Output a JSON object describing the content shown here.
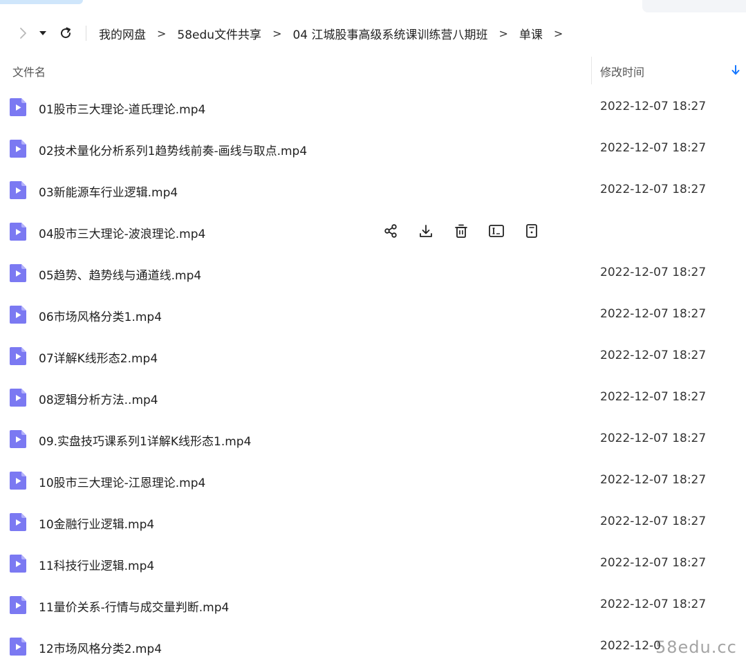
{
  "breadcrumb": [
    {
      "label": "我的网盘"
    },
    {
      "label": "58edu文件共享"
    },
    {
      "label": "04 江城股事高级系统课训练营八期班"
    },
    {
      "label": "单课"
    }
  ],
  "breadcrumb_separator": ">",
  "columns": {
    "name": "文件名",
    "modified": "修改时间"
  },
  "files": [
    {
      "name": "01股市三大理论-道氏理论.mp4",
      "time": "2022-12-07 18:27"
    },
    {
      "name": "02技术量化分析系列1趋势线前奏-画线与取点.mp4",
      "time": "2022-12-07 18:27"
    },
    {
      "name": "03新能源车行业逻辑.mp4",
      "time": "2022-12-07 18:27"
    },
    {
      "name": "04股市三大理论-波浪理论.mp4",
      "time": ""
    },
    {
      "name": "05趋势、趋势线与通道线.mp4",
      "time": "2022-12-07 18:27"
    },
    {
      "name": "06市场风格分类1.mp4",
      "time": "2022-12-07 18:27"
    },
    {
      "name": "07详解K线形态2.mp4",
      "time": "2022-12-07 18:27"
    },
    {
      "name": "08逻辑分析方法..mp4",
      "time": "2022-12-07 18:27"
    },
    {
      "name": "09.实盘技巧课系列1详解K线形态1.mp4",
      "time": "2022-12-07 18:27"
    },
    {
      "name": "10股市三大理论-江恩理论.mp4",
      "time": "2022-12-07 18:27"
    },
    {
      "name": "10金融行业逻辑.mp4",
      "time": "2022-12-07 18:27"
    },
    {
      "name": "11科技行业逻辑.mp4",
      "time": "2022-12-07 18:27"
    },
    {
      "name": "11量价关系-行情与成交量判断.mp4",
      "time": "2022-12-07 18:27"
    },
    {
      "name": "12市场风格分类2.mp4",
      "time": "2022-12-0"
    }
  ],
  "hover_row_index": 3,
  "hover_actions": [
    "share-icon",
    "download-icon",
    "delete-icon",
    "rename-icon",
    "details-icon"
  ],
  "watermark": "58edu.cc",
  "colors": {
    "file_icon": "#7b79f2",
    "file_icon_fold": "#b3b1fb",
    "sort_arrow": "#1677ff"
  }
}
